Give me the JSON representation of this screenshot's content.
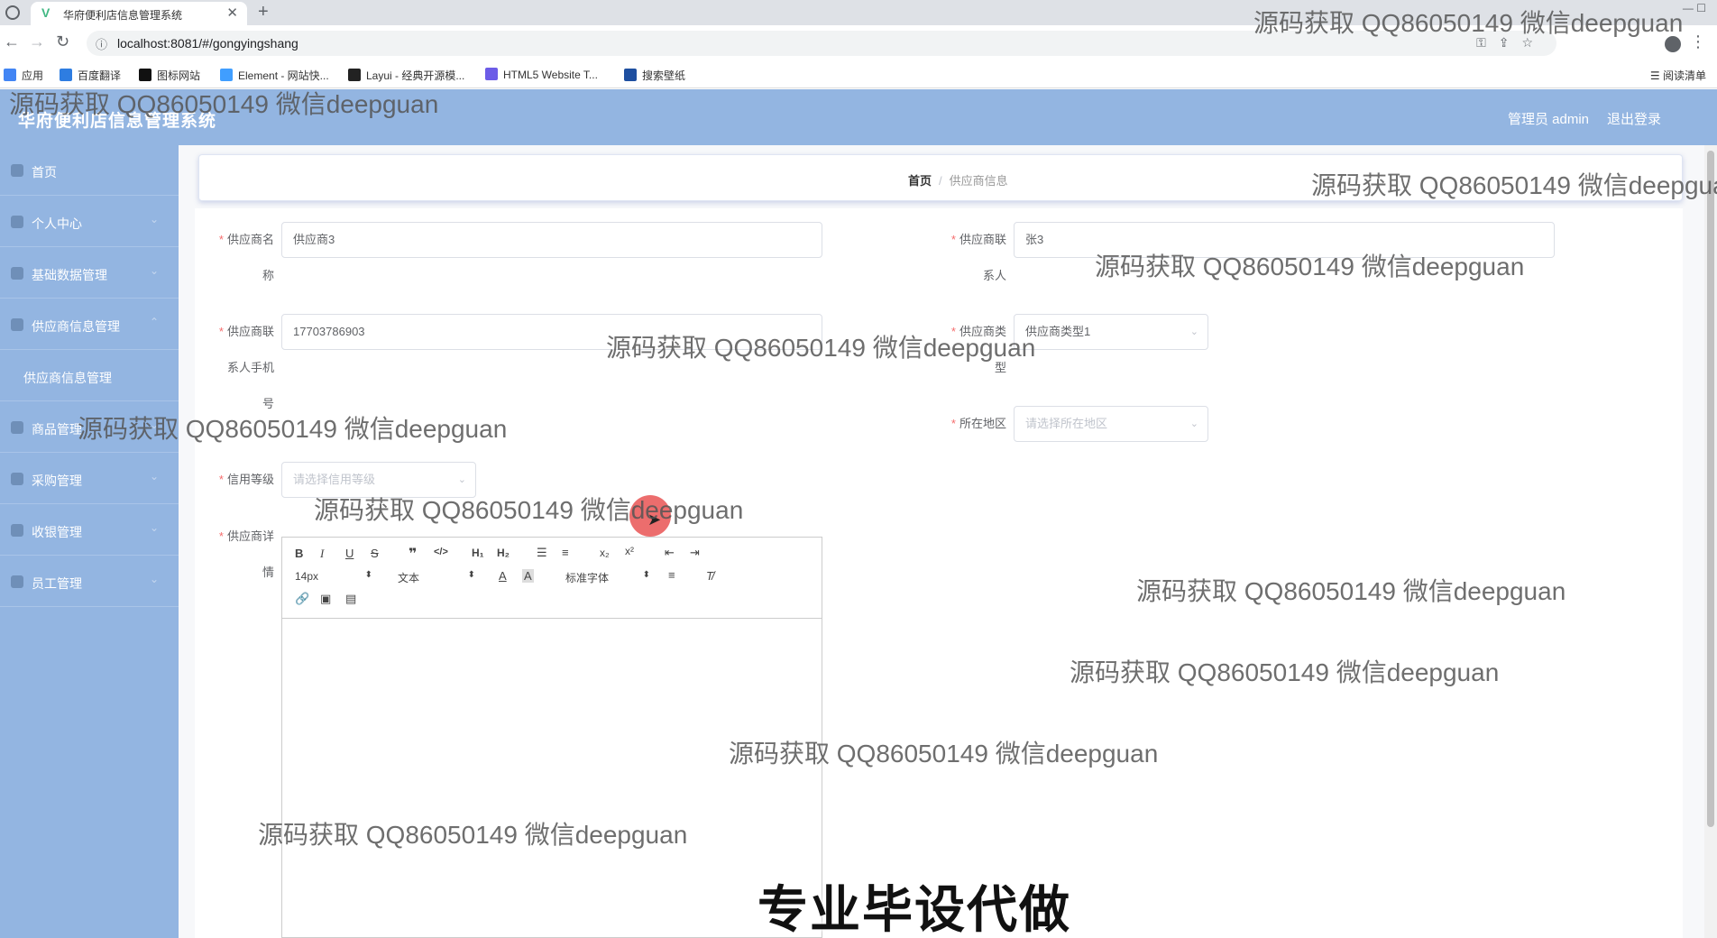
{
  "browser": {
    "tab_title": "华府便利店信息管理系统",
    "tab_close": "✕",
    "new_tab": "+",
    "url": "localhost:8081/#/gongyingshang",
    "bookmarks_apps": "应用",
    "bookmarks": [
      {
        "label": "百度翻译",
        "color": "#2e7de1"
      },
      {
        "label": "图标网站",
        "color": "#111111"
      },
      {
        "label": "Element - 网站快...",
        "color": "#409eff"
      },
      {
        "label": "Layui - 经典开源模...",
        "color": "#222222"
      },
      {
        "label": "HTML5 Website T...",
        "color": "#6c5ce7"
      },
      {
        "label": "搜索壁纸",
        "color": "#1e4fa0"
      }
    ],
    "reading_list": "阅读清单"
  },
  "header": {
    "title": "华府便利店信息管理系统",
    "user": "管理员 admin",
    "logout": "退出登录"
  },
  "sidebar": {
    "items": [
      {
        "label": "首页"
      },
      {
        "label": "个人中心"
      },
      {
        "label": "基础数据管理"
      },
      {
        "label": "供应商信息管理"
      },
      {
        "label": "供应商信息管理"
      },
      {
        "label": "商品管理"
      },
      {
        "label": "采购管理"
      },
      {
        "label": "收银管理"
      },
      {
        "label": "员工管理"
      }
    ]
  },
  "breadcrumb": {
    "home": "首页",
    "separator": "/",
    "current": "供应商信息"
  },
  "form": {
    "name_label_1": "供应商名",
    "name_label_2": "称",
    "name_value": "供应商3",
    "contact_label_1": "供应商联",
    "contact_label_2": "系人",
    "contact_value": "张3",
    "phone_label_1": "供应商联",
    "phone_label_2": "系人手机",
    "phone_label_3": "号",
    "phone_value": "17703786903",
    "type_label_1": "供应商类",
    "type_label_2": "型",
    "type_value": "供应商类型1",
    "region_label": "所在地区",
    "region_placeholder": "请选择所在地区",
    "credit_label": "信用等级",
    "credit_placeholder": "请选择信用等级",
    "detail_label_1": "供应商详",
    "detail_label_2": "情",
    "required_mark": "*"
  },
  "editor": {
    "font_size": "14px",
    "header_select": "文本",
    "font_select": "标准字体"
  },
  "watermark": "源码获取 QQ86050149 微信deepguan",
  "promo": "专业毕设代做"
}
